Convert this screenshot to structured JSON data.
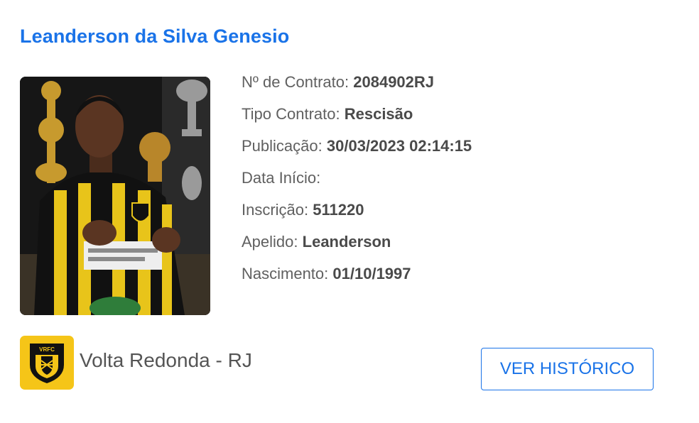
{
  "player": {
    "name": "Leanderson da Silva Genesio"
  },
  "details": [
    {
      "label": "Nº de Contrato:",
      "value": "2084902RJ"
    },
    {
      "label": "Tipo Contrato:",
      "value": "Rescisão"
    },
    {
      "label": "Publicação:",
      "value": "30/03/2023 02:14:15"
    },
    {
      "label": "Data Início:",
      "value": ""
    },
    {
      "label": "Inscrição:",
      "value": "511220"
    },
    {
      "label": "Apelido:",
      "value": "Leanderson"
    },
    {
      "label": "Nascimento:",
      "value": "01/10/1997"
    }
  ],
  "club": {
    "name": "Volta Redonda - RJ",
    "logo_text": "VRFC",
    "logo_color": "#f5c518"
  },
  "actions": {
    "history_label": "VER HISTÓRICO"
  },
  "colors": {
    "accent": "#1a73e8",
    "label": "#606060",
    "value": "#4a4a4a"
  }
}
